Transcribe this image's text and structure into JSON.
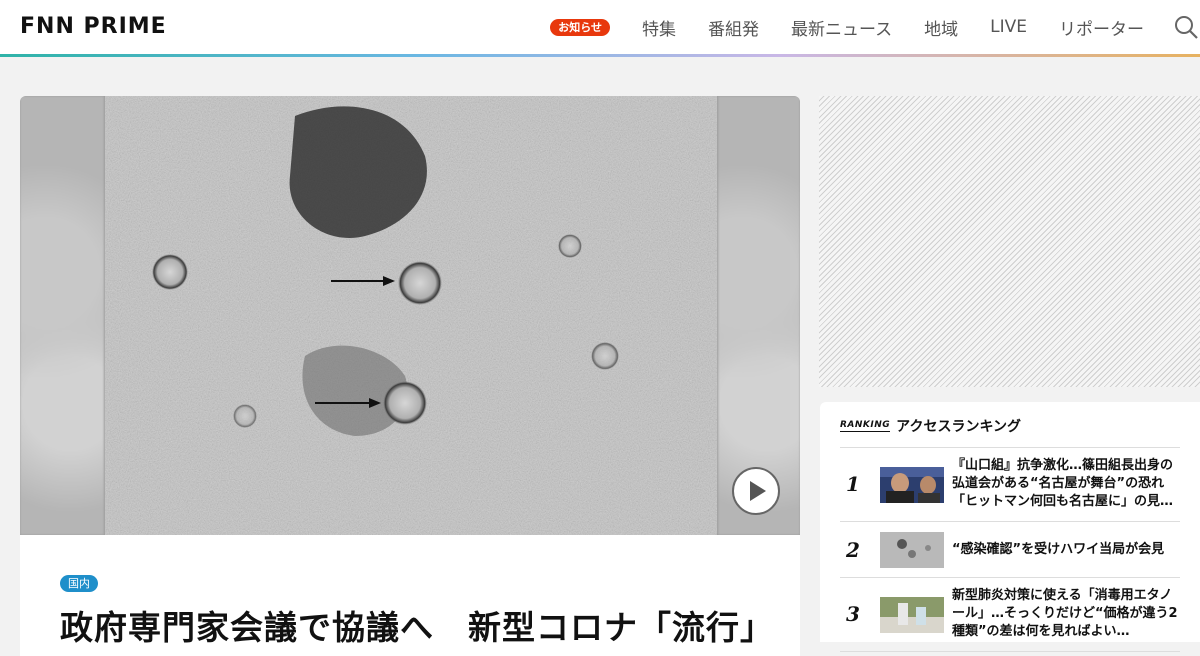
{
  "header": {
    "logo": "FNN PRIME",
    "badge": "お知らせ",
    "nav": [
      "特集",
      "番組発",
      "最新ニュース",
      "地域",
      "LIVE",
      "リポーター"
    ]
  },
  "hero": {
    "category": "国内",
    "headline": "政府専門家会議で協議へ　新型コロナ「流行」"
  },
  "ranking": {
    "label_en": "RANKING",
    "title": "アクセスランキング",
    "items": [
      {
        "rank": "1",
        "text": "『山口組』抗争激化…篠田組長出身の弘道会がある“名古屋が舞台”の恐れ「ヒットマン何回も名古屋に」の見…"
      },
      {
        "rank": "2",
        "text": "“感染確認”を受けハワイ当局が会見"
      },
      {
        "rank": "3",
        "text": "新型肺炎対策に使える「消毒用エタノール」…そっくりだけど“価格が違う2種類”の差は何を見ればよい…"
      }
    ]
  },
  "colors": {
    "accent_red": "#e8380d",
    "category_blue": "#1f8fca"
  }
}
